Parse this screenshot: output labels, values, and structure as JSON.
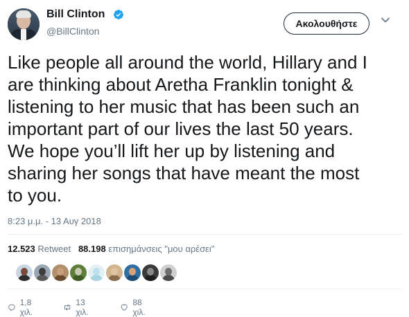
{
  "author": {
    "display_name": "Bill Clinton",
    "handle": "@BillClinton"
  },
  "follow_button_label": "Ακολουθήστε",
  "tweet": {
    "lines": [
      "Like people all around the world, Hillary and I",
      "are thinking about Aretha Franklin tonight &",
      "listening to her music that has been such an",
      "important part of our lives the last 50 years.",
      "We hope you’ll lift her up by listening and",
      "sharing her songs that have meant the most",
      "to you."
    ],
    "timestamp": "8:23 μ.μ. - 13 Αυγ 2018"
  },
  "stats": {
    "retweets_count": "12.523",
    "retweets_label": "Retweet",
    "likes_count": "88.198",
    "likes_label": "επισημάνσεις \"μου αρέσει\""
  },
  "liker_avatars": [
    {
      "bg": "#c9d6e3",
      "head": "#7a4b3a",
      "body": "#2e2e2e"
    },
    {
      "bg": "#9aa7b3",
      "head": "#3c3c3c",
      "body": "#5a5a5a"
    },
    {
      "bg": "#b08f6a",
      "head": "#caa07c",
      "body": "#6b4a2f"
    },
    {
      "bg": "#5d7f3a",
      "head": "#c9c9b0",
      "body": "#3f5b26"
    },
    {
      "bg": "#e3f1f5",
      "head": "#bde0ec",
      "body": "#a8d4e2"
    },
    {
      "bg": "#d0b58f",
      "head": "#e0c3a0",
      "body": "#8a6b4a"
    },
    {
      "bg": "#2f6fa3",
      "head": "#d8a27a",
      "body": "#1f4b73"
    },
    {
      "bg": "#3a3a3a",
      "head": "#8a8a8a",
      "body": "#1e1e1e"
    },
    {
      "bg": "#cfcfcf",
      "head": "#6e6e6e",
      "body": "#4a4a4a"
    }
  ],
  "actions": {
    "replies": "1,8 χιλ.",
    "retweets": "13 χιλ.",
    "likes": "88 χιλ."
  },
  "colors": {
    "text": "#14171a",
    "secondary": "#657786",
    "verified": "#1da1f2",
    "divider": "#e6ecf0"
  },
  "icons": [
    "verified-badge-icon",
    "chevron-down-icon",
    "reply-icon",
    "retweet-icon",
    "heart-icon"
  ]
}
